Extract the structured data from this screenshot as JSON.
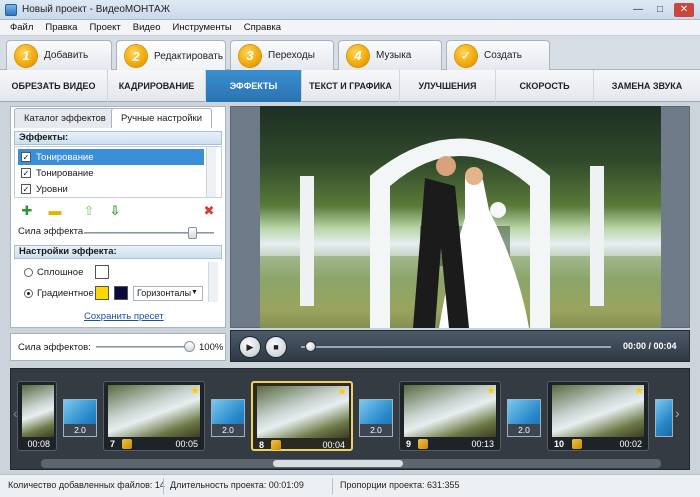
{
  "window": {
    "title": "Новый проект - ВидеоМОНТАЖ",
    "minimize": "—",
    "maximize": "□",
    "close": "✕"
  },
  "menu": [
    "Файл",
    "Правка",
    "Проект",
    "Видео",
    "Инструменты",
    "Справка"
  ],
  "steps": [
    {
      "num": "1",
      "label": "Добавить"
    },
    {
      "num": "2",
      "label": "Редактировать"
    },
    {
      "num": "3",
      "label": "Переходы"
    },
    {
      "num": "4",
      "label": "Музыка"
    },
    {
      "num": "✓",
      "label": "Создать"
    }
  ],
  "subtabs": [
    "ОБРЕЗАТЬ ВИДЕО",
    "КАДРИРОВАНИЕ",
    "ЭФФЕКТЫ",
    "ТЕКСТ И ГРАФИКА",
    "УЛУЧШЕНИЯ",
    "СКОРОСТЬ",
    "ЗАМЕНА ЗВУКА"
  ],
  "panel": {
    "tab_catalog": "Каталог эффектов",
    "tab_manual": "Ручные настройки",
    "effects_header": "Эффекты:",
    "effects": [
      "Тонирование",
      "Тонирование",
      "Уровни"
    ],
    "strength_label": "Сила эффекта",
    "strength_value": 0.8,
    "settings_header": "Настройки эффекта:",
    "solid_label": "Сплошное",
    "gradient_label": "Градиентное",
    "gradient_mode": "Горизонталы",
    "save_preset": "Сохранить пресет",
    "colors": {
      "solid": "#ffffff",
      "grad1": "#ffd700",
      "grad2": "#0a0a3c"
    }
  },
  "effects_strength": {
    "label": "Сила эффектов:",
    "value": "100%"
  },
  "player": {
    "time": "00:00 / 00:04"
  },
  "timeline": {
    "clips": [
      {
        "num": "",
        "time": "00:08"
      },
      {
        "num": "7",
        "time": "00:05"
      },
      {
        "num": "8",
        "time": "00:04"
      },
      {
        "num": "9",
        "time": "00:13"
      },
      {
        "num": "10",
        "time": "00:02"
      }
    ],
    "transition": "2.0"
  },
  "status": {
    "files": "Количество добавленных файлов: 14",
    "duration": "Длительность проекта: 00:01:09",
    "ratio": "Пропорции проекта: 631:355"
  }
}
